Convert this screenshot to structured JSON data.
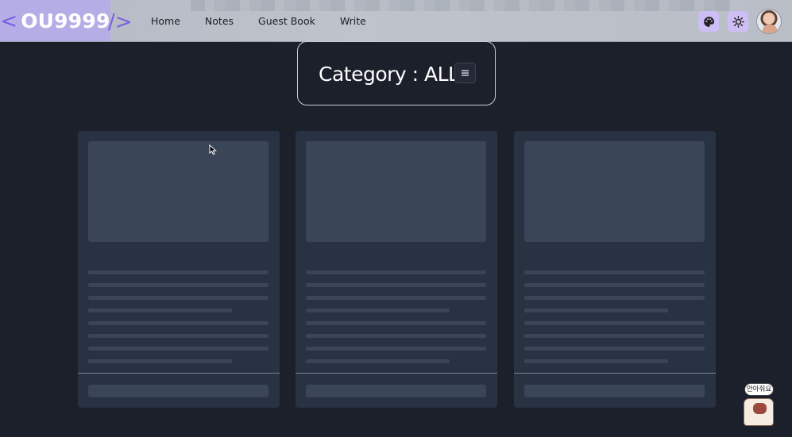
{
  "header": {
    "logo": {
      "open": "<",
      "brand": "OU9999",
      "close": "/>"
    },
    "nav": [
      {
        "label": "Home"
      },
      {
        "label": "Notes"
      },
      {
        "label": "Guest Book"
      },
      {
        "label": "Write"
      }
    ],
    "icons": [
      "palette-icon",
      "sun-icon",
      "avatar"
    ]
  },
  "category": {
    "title": "Category : ALL",
    "menu_icon": "menu-icon"
  },
  "cards_state": "loading-skeleton",
  "card_count": 3,
  "mascot": {
    "bubble_text": "안아줘요"
  },
  "colors": {
    "page_bg": "#1b202b",
    "card_bg": "#283242",
    "skeleton": "#3a4557",
    "accent": "#7b5fe0",
    "icon_button_bg": "#cdbff5"
  }
}
